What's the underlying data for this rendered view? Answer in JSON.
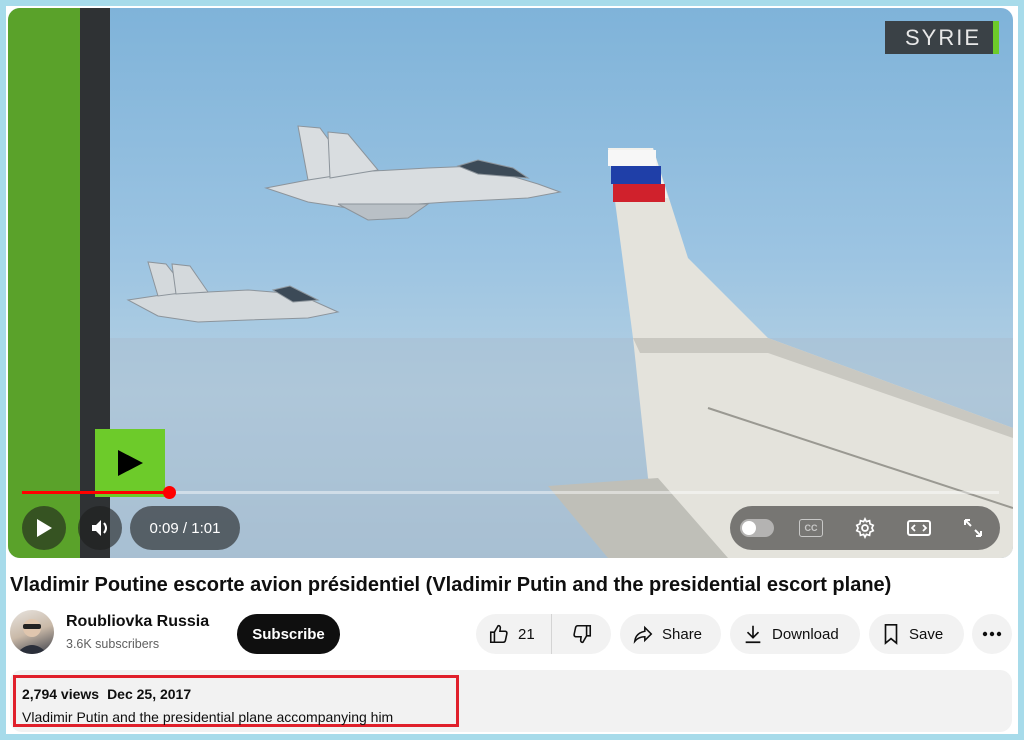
{
  "video": {
    "overlay_badge": "SYRIE",
    "current_time": "0:09",
    "duration": "1:01",
    "time_display": "0:09 / 1:01",
    "progress_fraction": 0.147,
    "controls": {
      "play": "play-icon",
      "volume": "volume-icon",
      "autoplay": "autoplay-toggle",
      "captions": "CC",
      "settings": "gear-icon",
      "theater": "theater-icon",
      "fullscreen": "fullscreen-icon"
    }
  },
  "title": "Vladimir Poutine escorte avion présidentiel (Vladimir Putin and the presidential escort plane)",
  "channel": {
    "name": "Roubliovka Russia",
    "subscribers": "3.6K subscribers",
    "subscribe_label": "Subscribe"
  },
  "actions": {
    "likes": "21",
    "share_label": "Share",
    "download_label": "Download",
    "save_label": "Save"
  },
  "description": {
    "views": "2,794 views",
    "date": "Dec 25, 2017",
    "text": "Vladimir Putin and the presidential plane accompanying him"
  },
  "colors": {
    "progress": "#ff0000",
    "subscribe_bg": "#0f0f0f",
    "highlight_border": "#e0202b",
    "frame_border": "#a7dbea",
    "rt_green": "#6dcb2a"
  }
}
